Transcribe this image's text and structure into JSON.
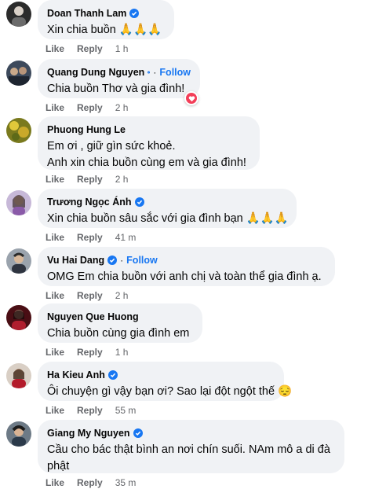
{
  "colors": {
    "bubble": "#f0f2f5",
    "follow": "#1877f2",
    "meta": "#65676b",
    "verified": "#1877f2",
    "heart": "#f33e58"
  },
  "actions": {
    "like": "Like",
    "reply": "Reply"
  },
  "comments": [
    {
      "name": "Doan Thanh Lam",
      "verified": true,
      "follow": "",
      "lines": [
        "Xin chia buồn 🙏🙏🙏"
      ],
      "time": "1 h"
    },
    {
      "name": "Quang Dung Nguyen",
      "verified": true,
      "follow": "Follow",
      "lines": [
        "Chia buồn Thơ và gia đình!"
      ],
      "time": "2 h",
      "reaction": "heart-icon"
    },
    {
      "name": "Phuong Hung Le",
      "verified": false,
      "follow": "",
      "lines": [
        "Em ơi , giữ gìn sức khoẻ.",
        "Anh xin chia buồn cùng em và gia đình!"
      ],
      "time": "2 h"
    },
    {
      "name": "Trương Ngọc Ánh",
      "verified": true,
      "follow": "",
      "lines": [
        "Xin chia buồn sâu sắc với gia đình bạn 🙏🙏🙏"
      ],
      "time": "41 m"
    },
    {
      "name": "Vu Hai Dang",
      "verified": true,
      "follow": "Follow",
      "lines": [
        "OMG Em chia buồn với anh chị và toàn thể gia đình ạ."
      ],
      "time": "2 h"
    },
    {
      "name": "Nguyen Que Huong",
      "verified": false,
      "follow": "",
      "lines": [
        "Chia buồn cùng gia đình em"
      ],
      "time": "1 h"
    },
    {
      "name": "Ha Kieu Anh",
      "verified": true,
      "follow": "",
      "lines": [
        "Ôi chuyện gì vậy bạn ơi? Sao lại đột ngột thế 😔"
      ],
      "time": "55 m"
    },
    {
      "name": "Giang My Nguyen",
      "verified": true,
      "follow": "",
      "lines": [
        "Cầu cho bác thật bình an nơi chín suối. NAm mô a di đà",
        "phật"
      ],
      "time": "35 m"
    }
  ]
}
